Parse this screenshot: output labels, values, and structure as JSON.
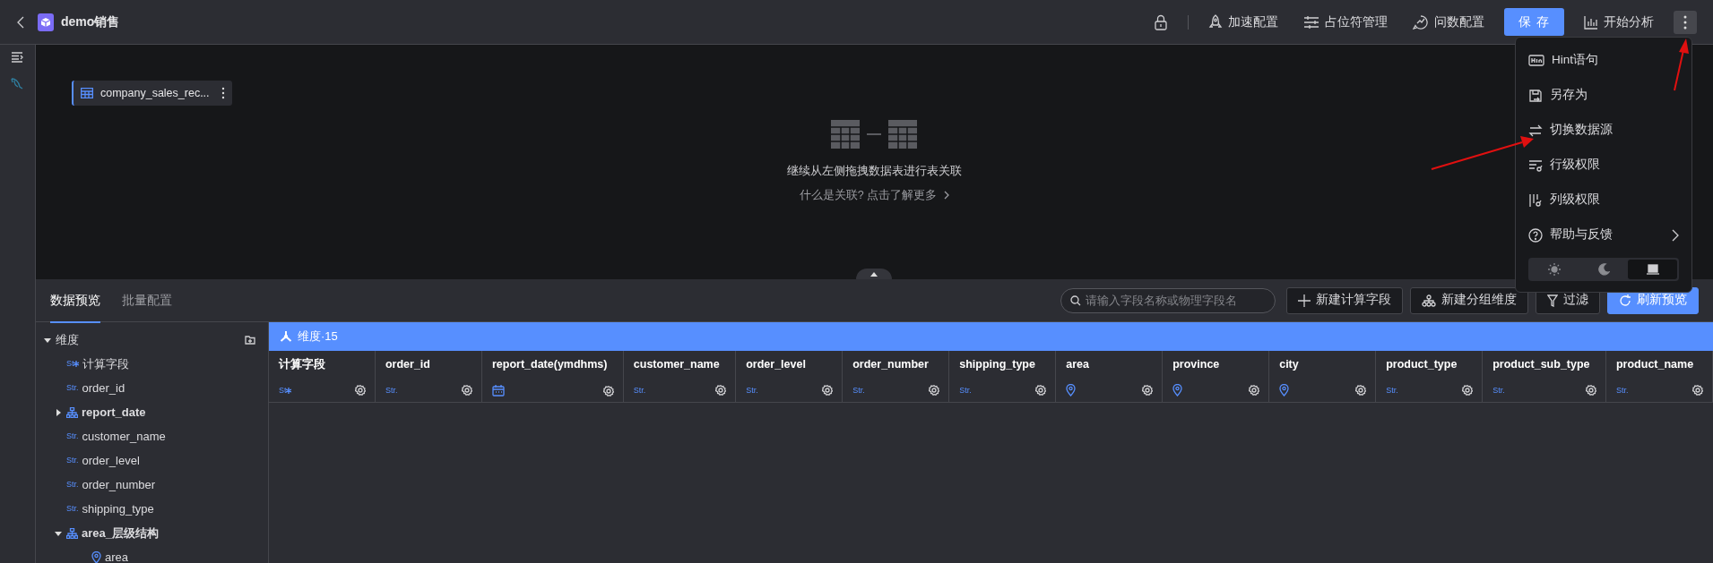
{
  "header": {
    "title": "demo销售",
    "actions": [
      {
        "kind": "lock"
      },
      {
        "kind": "rocket",
        "label": "加速配置"
      },
      {
        "kind": "sliders",
        "label": "占位符管理"
      },
      {
        "kind": "chat",
        "label": "问数配置"
      },
      {
        "kind": "primary",
        "label": "保 存"
      },
      {
        "kind": "chart",
        "label": "开始分析"
      },
      {
        "kind": "more",
        "selected": true
      }
    ]
  },
  "menu": {
    "items": [
      {
        "kind": "hint",
        "label": "Hint语句"
      },
      {
        "kind": "saveas",
        "label": "另存为"
      },
      {
        "kind": "switch",
        "label": "切换数据源"
      },
      {
        "kind": "rowperm",
        "label": "行级权限"
      },
      {
        "kind": "colperm",
        "label": "列级权限"
      },
      {
        "kind": "help",
        "label": "帮助与反馈",
        "submenu": true
      }
    ],
    "themes": [
      {
        "kind": "light",
        "selected": false
      },
      {
        "kind": "dark",
        "selected": false
      },
      {
        "kind": "system",
        "selected": true
      }
    ]
  },
  "canvas": {
    "table_node": "company_sales_rec...",
    "hint": "继续从左侧拖拽数据表进行表关联",
    "link": "什么是关联? 点击了解更多"
  },
  "tabs": [
    {
      "label": "数据预览",
      "selected": true
    },
    {
      "label": "批量配置",
      "selected": false
    }
  ],
  "toolbar": {
    "search": {
      "placeholder": "请输入字段名称或物理字段名"
    },
    "buttons": [
      {
        "kind": "plus",
        "label": "新建计算字段"
      },
      {
        "kind": "group",
        "label": "新建分组维度"
      },
      {
        "kind": "filter",
        "label": "过滤"
      },
      {
        "kind": "refresh",
        "label": "刷新预览"
      }
    ]
  },
  "tree": [
    {
      "kind": "group",
      "label": "维度",
      "expanded": true,
      "children": [
        {
          "kind": "calc",
          "type_label": "St",
          "label": "计算字段"
        },
        {
          "kind": "str",
          "type_label": "Str.",
          "label": "order_id"
        },
        {
          "kind": "hier",
          "label": "report_date",
          "expanded": false
        },
        {
          "kind": "str",
          "type_label": "Str.",
          "label": "customer_name"
        },
        {
          "kind": "str",
          "type_label": "Str.",
          "label": "order_level"
        },
        {
          "kind": "str",
          "type_label": "Str.",
          "label": "order_number"
        },
        {
          "kind": "str",
          "type_label": "Str.",
          "label": "shipping_type"
        },
        {
          "kind": "hier",
          "label": "area_层级结构",
          "expanded": true,
          "children": [
            {
              "kind": "geo",
              "label": "area"
            }
          ]
        }
      ]
    }
  ],
  "band": {
    "label": "维度·15"
  },
  "columns": [
    {
      "name": "计算字段",
      "kind": "calc",
      "type_label": "St"
    },
    {
      "name": "order_id",
      "kind": "str",
      "type_label": "Str."
    },
    {
      "name": "report_date(ymdhms)",
      "kind": "date"
    },
    {
      "name": "customer_name",
      "kind": "str",
      "type_label": "Str."
    },
    {
      "name": "order_level",
      "kind": "str",
      "type_label": "Str."
    },
    {
      "name": "order_number",
      "kind": "str",
      "type_label": "Str."
    },
    {
      "name": "shipping_type",
      "kind": "str",
      "type_label": "Str."
    },
    {
      "name": "area",
      "kind": "geo"
    },
    {
      "name": "province",
      "kind": "geo"
    },
    {
      "name": "city",
      "kind": "geo"
    },
    {
      "name": "product_type",
      "kind": "str",
      "type_label": "Str."
    },
    {
      "name": "product_sub_type",
      "kind": "str",
      "type_label": "Str."
    },
    {
      "name": "product_name",
      "kind": "str",
      "type_label": "Str."
    }
  ]
}
